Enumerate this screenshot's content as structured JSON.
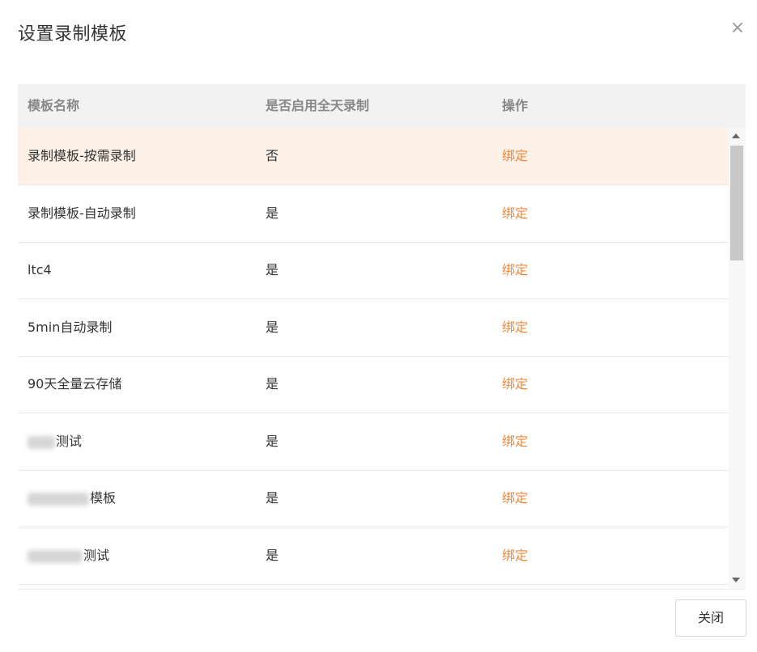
{
  "dialog": {
    "title": "设置录制模板",
    "close_icon": "×",
    "close_button_label": "关闭"
  },
  "table": {
    "headers": [
      "模板名称",
      "是否启用全天录制",
      "操作"
    ],
    "rows": [
      {
        "name": "录制模板-按需录制",
        "all_day": "否",
        "action": "绑定"
      },
      {
        "name": "录制模板-自动录制",
        "all_day": "是",
        "action": "绑定"
      },
      {
        "name": "ltc4",
        "all_day": "是",
        "action": "绑定"
      },
      {
        "name": "5min自动录制",
        "all_day": "是",
        "action": "绑定"
      },
      {
        "name": "90天全量云存储",
        "all_day": "是",
        "action": "绑定"
      },
      {
        "name": "测试",
        "all_day": "是",
        "action": "绑定"
      },
      {
        "name": "模板",
        "all_day": "是",
        "action": "绑定"
      },
      {
        "name": "测试",
        "all_day": "是",
        "action": "绑定"
      }
    ]
  },
  "colors": {
    "accent": "#f0883a",
    "row_highlight": "#fdf1e8",
    "header_bg": "#f2f2f2"
  }
}
